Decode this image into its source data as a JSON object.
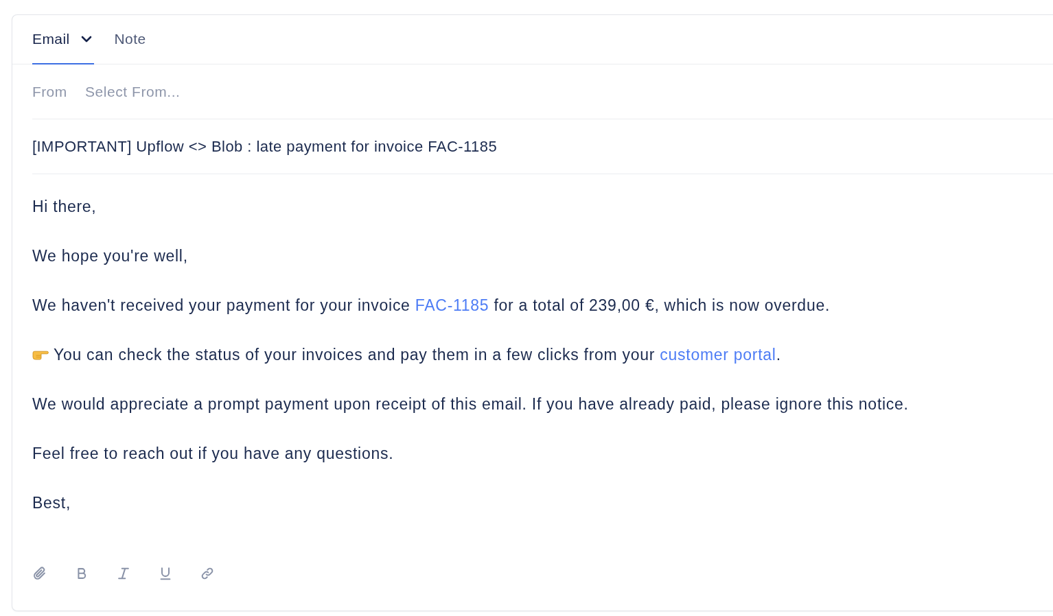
{
  "tabs": [
    {
      "label": "Email",
      "kind": "dropdown",
      "selected": true
    },
    {
      "label": "Note",
      "kind": "plain",
      "selected": false
    }
  ],
  "from": {
    "label": "From",
    "placeholder": "Select From..."
  },
  "subject": {
    "value": "[IMPORTANT] Upflow <> Blob : late payment for invoice FAC-1185"
  },
  "body": [
    {
      "kind": "plain",
      "parts": [
        {
          "kind": "text",
          "text": "Hi there,"
        }
      ]
    },
    {
      "kind": "plain",
      "parts": [
        {
          "kind": "text",
          "text": "We hope you're well,"
        }
      ]
    },
    {
      "kind": "plain",
      "parts": [
        {
          "kind": "text",
          "text": "We haven't received your payment for your invoice "
        },
        {
          "kind": "link",
          "text": "FAC-1185"
        },
        {
          "kind": "text",
          "text": " for a total of 239,00 €, which is now overdue."
        }
      ]
    },
    {
      "kind": "pointer",
      "parts": [
        {
          "kind": "text",
          "text": "You can check the status of your invoices and pay them in a few clicks from your "
        },
        {
          "kind": "link",
          "text": "customer portal"
        },
        {
          "kind": "text",
          "text": "."
        }
      ]
    },
    {
      "kind": "plain",
      "parts": [
        {
          "kind": "text",
          "text": "We would appreciate a prompt payment upon receipt of this email. If you have already paid, please ignore this notice."
        }
      ]
    },
    {
      "kind": "plain",
      "parts": [
        {
          "kind": "text",
          "text": "Feel free to reach out if you have any questions."
        }
      ]
    },
    {
      "kind": "plain",
      "parts": [
        {
          "kind": "text",
          "text": "Best,"
        }
      ]
    }
  ],
  "toolbar": [
    {
      "kind": "attach"
    },
    {
      "kind": "bold"
    },
    {
      "kind": "italic"
    },
    {
      "kind": "underline"
    },
    {
      "kind": "link"
    }
  ]
}
